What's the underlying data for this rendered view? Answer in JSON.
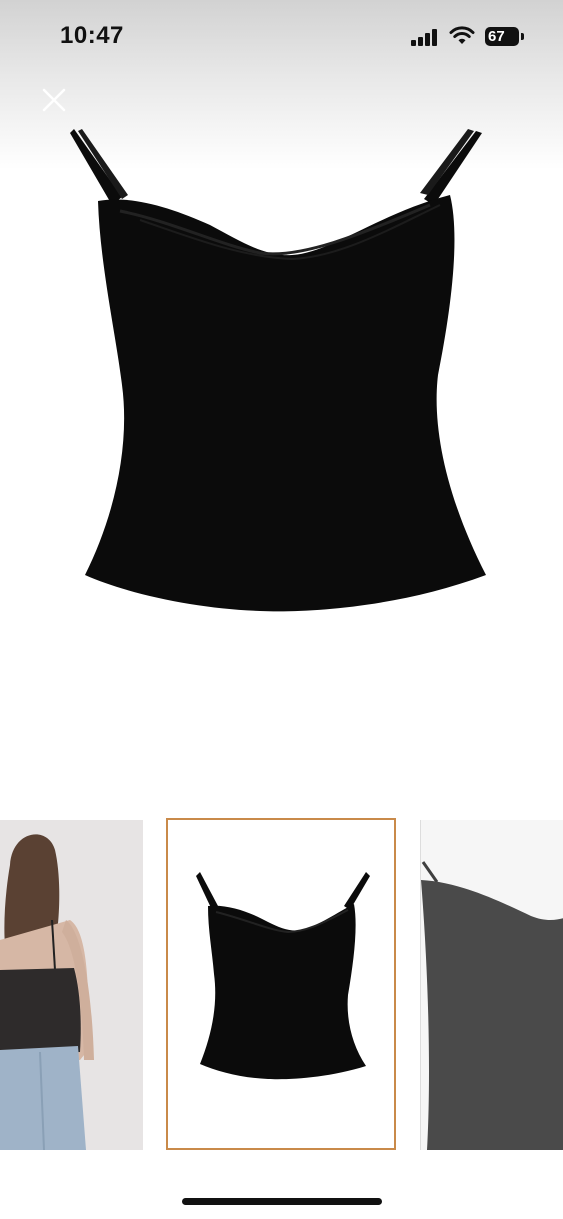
{
  "status_bar": {
    "time": "10:47",
    "battery_level": "67"
  },
  "icons": {
    "close": "close-icon",
    "signal": "cellular-signal-icon",
    "wifi": "wifi-icon",
    "battery": "battery-icon"
  },
  "gallery": {
    "selected_index": 1,
    "thumbnail_count": 3
  },
  "colors": {
    "selected_border": "#c98a4a",
    "garment": "#0b0b0b"
  }
}
